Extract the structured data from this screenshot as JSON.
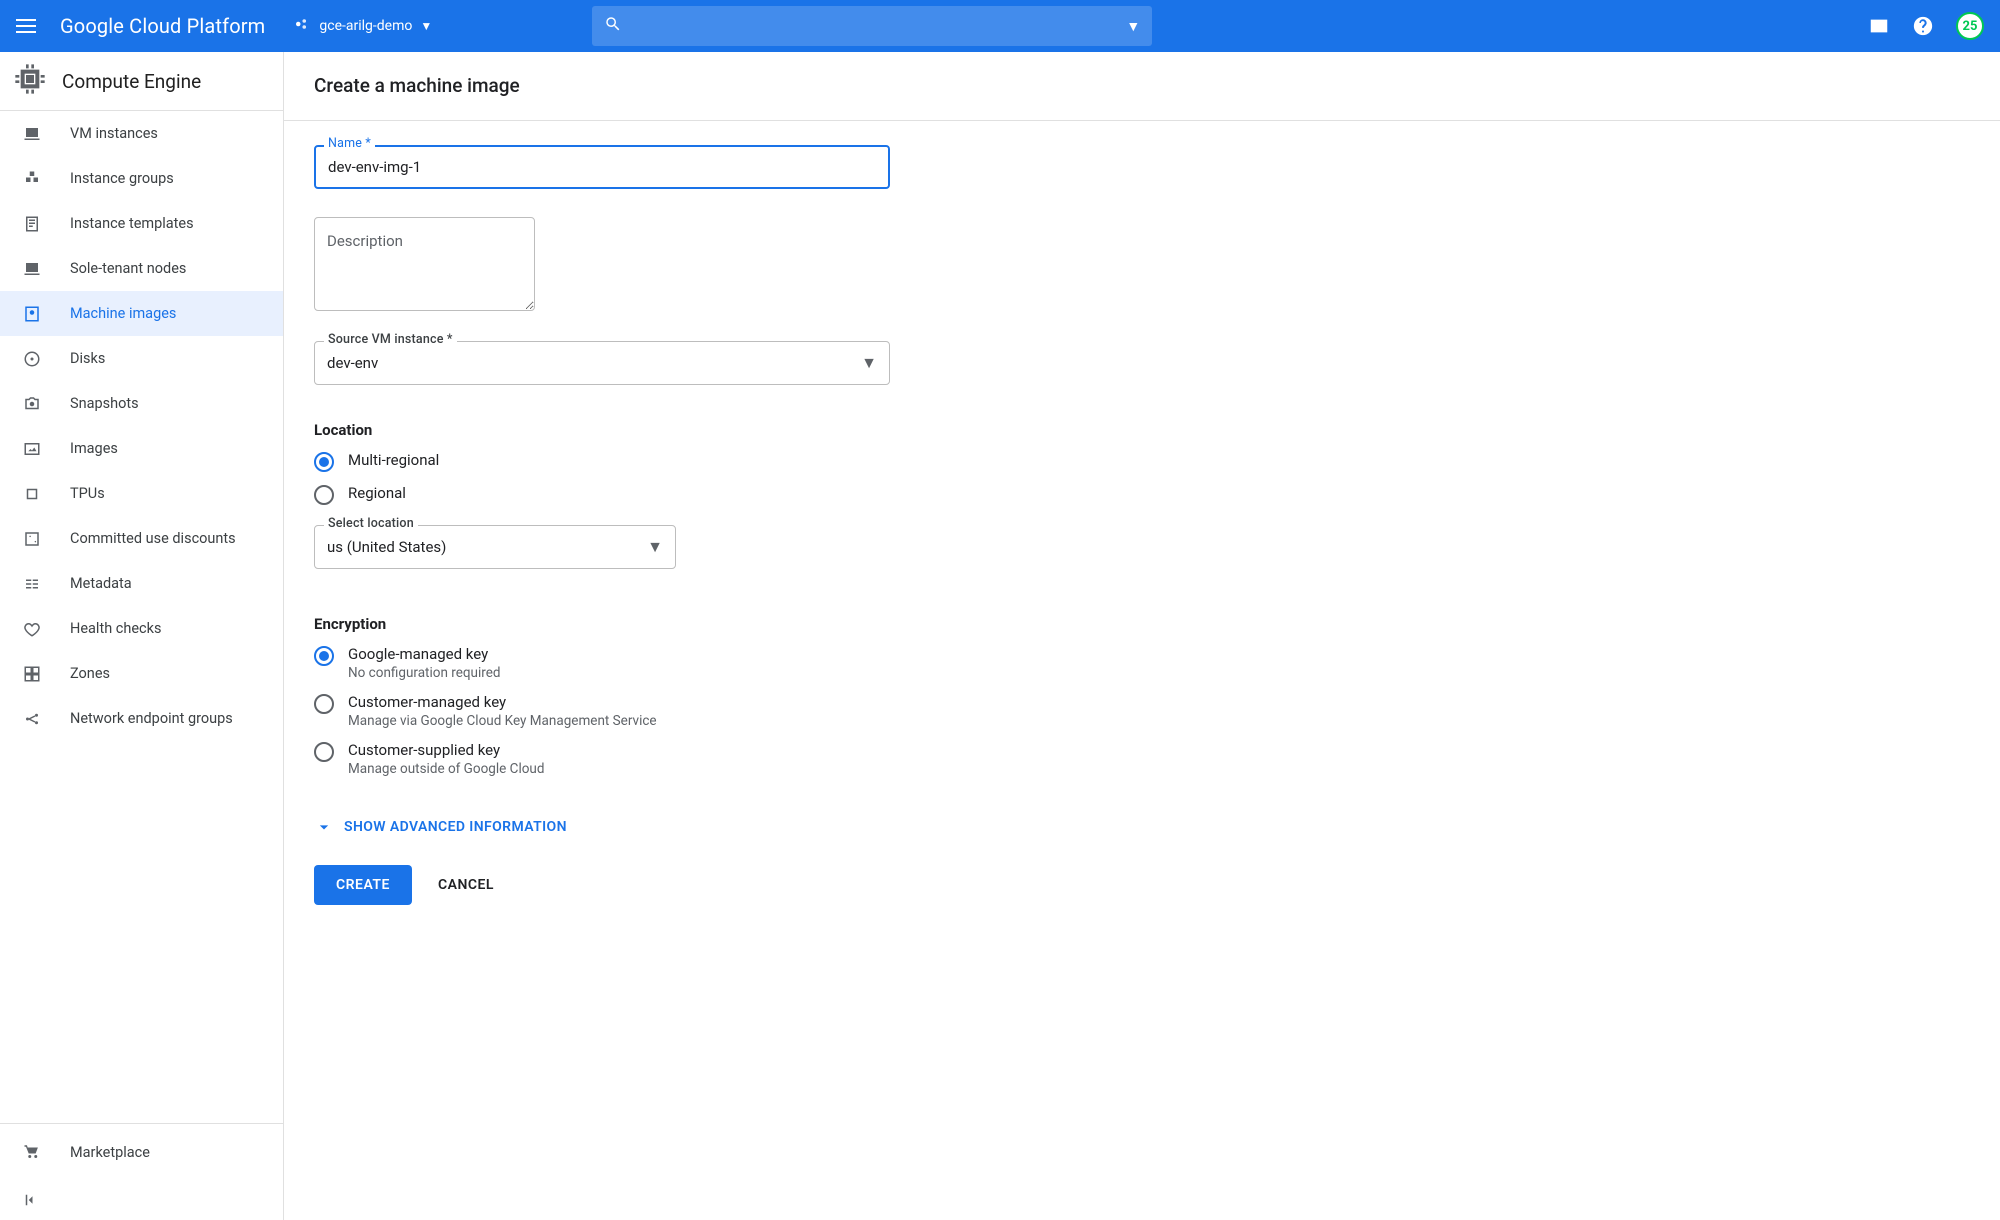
{
  "topbar": {
    "logo_text": "Google Cloud Platform",
    "project_name": "gce-arilg-demo",
    "search_placeholder": "",
    "credit_badge": "25"
  },
  "sidebar": {
    "service_title": "Compute Engine",
    "items": [
      {
        "label": "VM instances",
        "icon": "vm"
      },
      {
        "label": "Instance groups",
        "icon": "group"
      },
      {
        "label": "Instance templates",
        "icon": "template"
      },
      {
        "label": "Sole-tenant nodes",
        "icon": "node"
      },
      {
        "label": "Machine images",
        "icon": "machineimage",
        "active": true
      },
      {
        "label": "Disks",
        "icon": "disk"
      },
      {
        "label": "Snapshots",
        "icon": "snapshot"
      },
      {
        "label": "Images",
        "icon": "image"
      },
      {
        "label": "TPUs",
        "icon": "tpu"
      },
      {
        "label": "Committed use discounts",
        "icon": "percent"
      },
      {
        "label": "Metadata",
        "icon": "meta"
      },
      {
        "label": "Health checks",
        "icon": "health"
      },
      {
        "label": "Zones",
        "icon": "zones"
      },
      {
        "label": "Network endpoint groups",
        "icon": "neg"
      }
    ],
    "marketplace_label": "Marketplace"
  },
  "page": {
    "title": "Create a machine image",
    "name_label": "Name *",
    "name_value": "dev-env-img-1",
    "description_placeholder": "Description",
    "source_label": "Source VM instance *",
    "source_value": "dev-env",
    "location_heading": "Location",
    "location_options": [
      {
        "label": "Multi-regional",
        "selected": true
      },
      {
        "label": "Regional",
        "selected": false
      }
    ],
    "location_select_label": "Select location",
    "location_select_value": "us (United States)",
    "encryption_heading": "Encryption",
    "encryption_options": [
      {
        "label": "Google-managed key",
        "sub": "No configuration required",
        "selected": true
      },
      {
        "label": "Customer-managed key",
        "sub": "Manage via Google Cloud Key Management Service",
        "selected": false
      },
      {
        "label": "Customer-supplied key",
        "sub": "Manage outside of Google Cloud",
        "selected": false
      }
    ],
    "advanced_toggle": "SHOW ADVANCED INFORMATION",
    "create_label": "CREATE",
    "cancel_label": "CANCEL"
  }
}
